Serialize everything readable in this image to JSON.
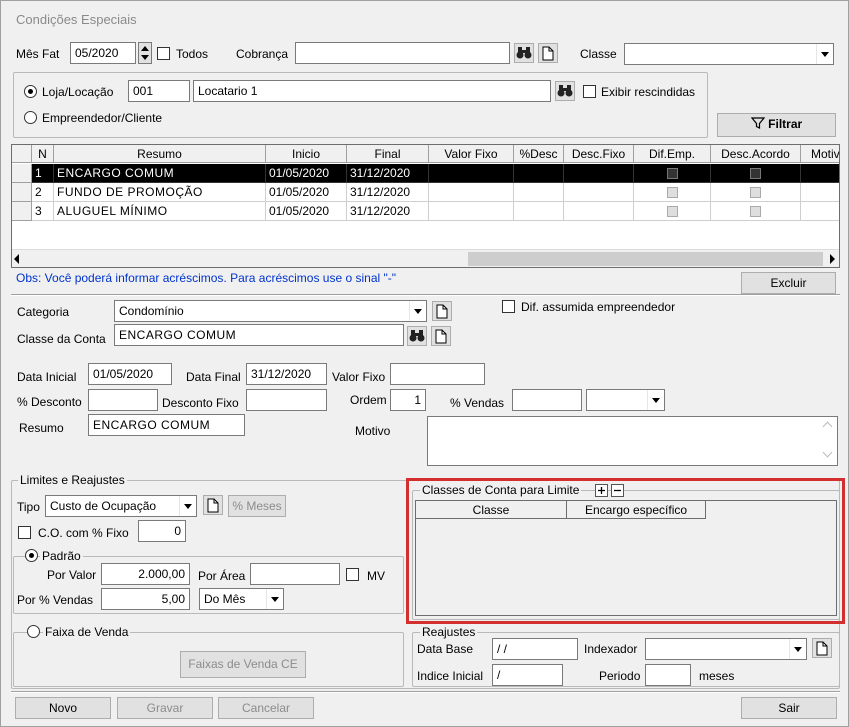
{
  "window": {
    "title": "Condições Especiais"
  },
  "top": {
    "mes_fat_label": "Mês Fat",
    "mes_fat_value": "05/2020",
    "todos_label": "Todos",
    "cobranca_label": "Cobrança",
    "cobranca_value": "",
    "classe_label": "Classe",
    "classe_value": "",
    "loja_label": "Loja/Locação",
    "loja_code": "001",
    "loja_name": "Locatario 1",
    "exibir_rescindidas_label": "Exibir rescindidas",
    "empreendedor_label": "Empreendedor/Cliente",
    "filtrar_label": "Filtrar"
  },
  "grid": {
    "columns": [
      "N",
      "Resumo",
      "Inicio",
      "Final",
      "Valor Fixo",
      "%Desc",
      "Desc.Fixo",
      "Dif.Emp.",
      "Desc.Acordo",
      "Motiv"
    ],
    "rows": [
      {
        "n": "1",
        "resumo": "ENCARGO COMUM",
        "inicio": "01/05/2020",
        "final": "31/12/2020",
        "selected": true
      },
      {
        "n": "2",
        "resumo": "FUNDO DE PROMOÇÃO",
        "inicio": "01/05/2020",
        "final": "31/12/2020",
        "selected": false
      },
      {
        "n": "3",
        "resumo": "ALUGUEL MÍNIMO",
        "inicio": "01/05/2020",
        "final": "31/12/2020",
        "selected": false
      }
    ]
  },
  "obs": "Obs: Você poderá informar acréscimos. Para acréscimos use o sinal \"-\"",
  "excluir_label": "Excluir",
  "detail": {
    "categoria_label": "Categoria",
    "categoria_value": "Condomínio",
    "dif_assumida_label": "Dif. assumida empreendedor",
    "classe_conta_label": "Classe da Conta",
    "classe_conta_value": "ENCARGO COMUM",
    "data_inicial_label": "Data Inicial",
    "data_inicial_value": "01/05/2020",
    "data_final_label": "Data Final",
    "data_final_value": "31/12/2020",
    "valor_fixo_label": "Valor Fixo",
    "valor_fixo_value": "",
    "pct_desconto_label": "% Desconto",
    "desconto_fixo_label": "Desconto Fixo",
    "ordem_label": "Ordem",
    "ordem_value": "1",
    "pct_vendas_label": "% Vendas",
    "resumo_label": "Resumo",
    "resumo_value": "ENCARGO COMUM",
    "motivo_label": "Motivo"
  },
  "limites": {
    "legend": "Limites e Reajustes",
    "tipo_label": "Tipo",
    "tipo_value": "Custo de Ocupação",
    "meses_label": "% Meses",
    "co_fixo_label": "C.O. com % Fixo",
    "co_fixo_value": "0",
    "padrao_label": "Padrão",
    "por_valor_label": "Por Valor",
    "por_valor_value": "2.000,00",
    "por_area_label": "Por Área",
    "mv_label": "MV",
    "por_vendas_label": "Por % Vendas",
    "por_vendas_value": "5,00",
    "periodo_value": "Do Mês",
    "faixa_legend": "Faixa de Venda",
    "faixas_button": "Faixas de Venda CE"
  },
  "classes_limite": {
    "legend": "Classes de Conta para Limite",
    "columns": [
      "Classe",
      "Encargo específico"
    ]
  },
  "reajustes": {
    "legend": "Reajustes",
    "data_base_label": "Data Base",
    "data_base_value": "/ /",
    "indexador_label": "Indexador",
    "indice_inicial_label": "Indice Inicial",
    "indice_inicial_value": "/",
    "periodo_label": "Periodo",
    "meses_label": "meses"
  },
  "footer": {
    "novo": "Novo",
    "gravar": "Gravar",
    "cancelar": "Cancelar",
    "sair": "Sair"
  },
  "colors": {
    "highlight_border": "#d32f2f",
    "link_blue": "#0033cc",
    "selected_row": "#000000"
  }
}
